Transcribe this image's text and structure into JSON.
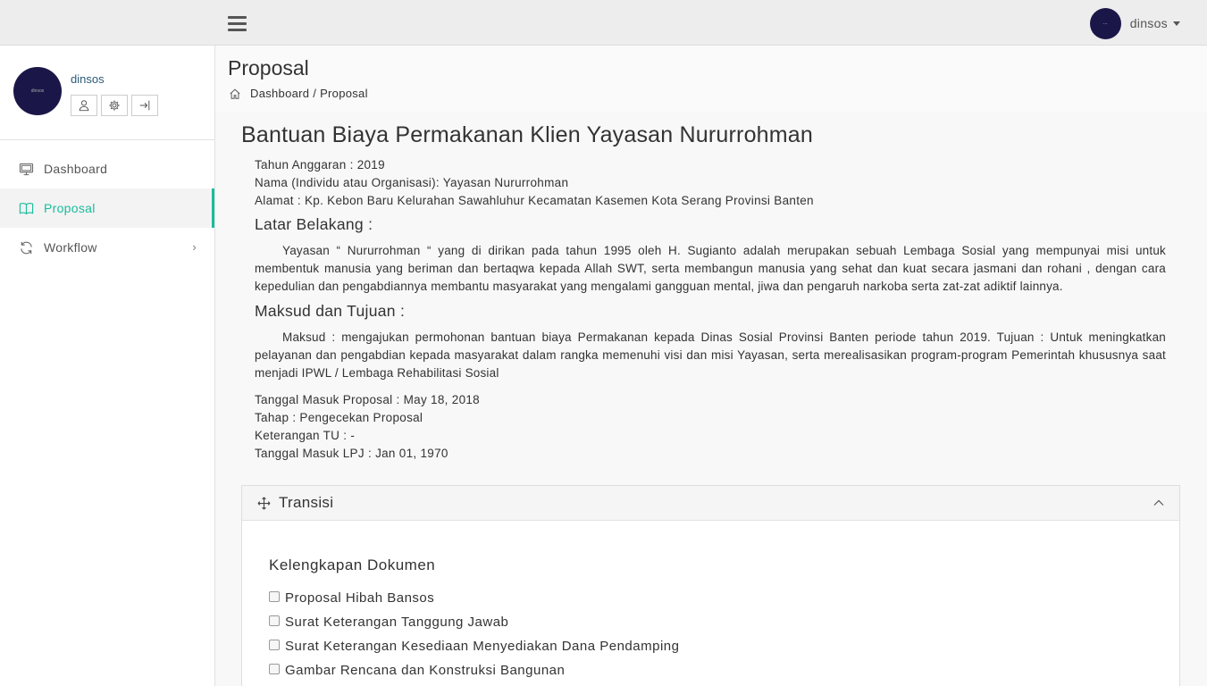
{
  "header": {
    "username": "dinsos",
    "avatar_text": "..."
  },
  "sidebar": {
    "profile_name": "dinsos",
    "avatar_text": "dinsos",
    "nav": [
      {
        "label": "Dashboard",
        "icon": "monitor-icon"
      },
      {
        "label": "Proposal",
        "icon": "book-icon"
      },
      {
        "label": "Workflow",
        "icon": "refresh-icon"
      }
    ],
    "workflow_chevron": "›"
  },
  "page": {
    "title": "Proposal",
    "breadcrumb": {
      "home": "Dashboard",
      "separator": " / ",
      "current": "Proposal"
    }
  },
  "proposal": {
    "title": "Bantuan Biaya Permakanan Klien Yayasan Nururrohman",
    "tahun": "Tahun Anggaran : 2019",
    "nama": "Nama (Individu atau Organisasi): Yayasan Nururrohman",
    "alamat": "Alamat : Kp. Kebon Baru Kelurahan Sawahluhur Kecamatan Kasemen Kota Serang Provinsi Banten",
    "latar_heading": "Latar Belakang :",
    "latar_text": "Yayasan “ Nururrohman “ yang di dirikan pada tahun 1995 oleh H. Sugianto adalah merupakan sebuah Lembaga Sosial yang mempunyai misi untuk membentuk manusia yang beriman dan bertaqwa kepada Allah SWT, serta membangun manusia yang sehat dan kuat secara jasmani dan rohani , dengan cara kepedulian dan pengabdiannya membantu masyarakat yang mengalami gangguan mental, jiwa dan pengaruh narkoba serta zat-zat adiktif lainnya.",
    "maksud_heading": "Maksud dan Tujuan :",
    "maksud_text": "Maksud : mengajukan permohonan bantuan biaya Permakanan kepada Dinas Sosial Provinsi Banten periode tahun 2019. Tujuan : Untuk meningkatkan pelayanan dan pengabdian kepada masyarakat dalam rangka memenuhi visi dan misi Yayasan, serta merealisasikan program-program Pemerintah khususnya saat menjadi IPWL / Lembaga Rehabilitasi Sosial",
    "tanggal_masuk": "Tanggal Masuk Proposal : May 18, 2018",
    "tahap": "Tahap : Pengecekan Proposal",
    "keterangan": "Keterangan TU : -",
    "tanggal_lpj": "Tanggal Masuk LPJ : Jan 01, 1970"
  },
  "transisi": {
    "title": "Transisi",
    "section_title": "Kelengkapan Dokumen",
    "documents": [
      {
        "label": "Proposal Hibah Bansos",
        "checked": false
      },
      {
        "label": "Surat Keterangan Tanggung Jawab",
        "checked": false
      },
      {
        "label": "Surat Keterangan Kesediaan Menyediakan Dana Pendamping",
        "checked": false
      },
      {
        "label": "Gambar Rencana dan Konstruksi Bangunan",
        "checked": false
      }
    ]
  },
  "colors": {
    "accent": "#1abc9c",
    "avatar_bg": "#1a1748",
    "topbar_bg": "#ededed"
  }
}
